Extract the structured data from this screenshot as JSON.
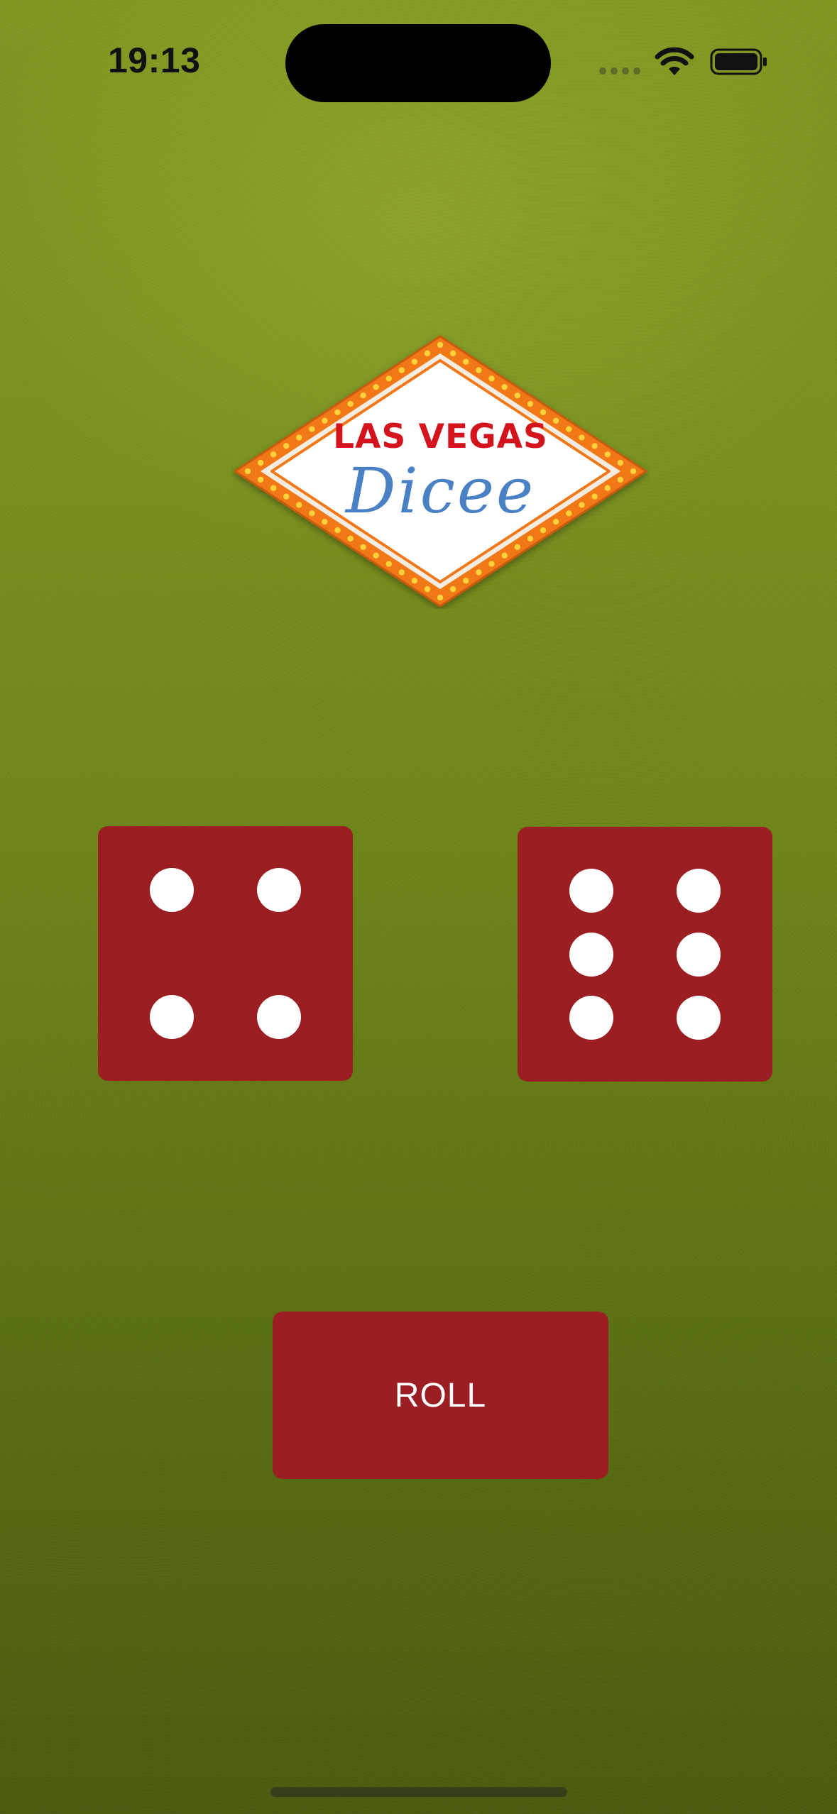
{
  "status_bar": {
    "time": "19:13",
    "icons": [
      "cellular-signal-icon",
      "wifi-icon",
      "battery-icon"
    ]
  },
  "logo": {
    "title": "LAS VEGAS",
    "script": "Dicee"
  },
  "dice": [
    {
      "name": "left-die",
      "value": 4
    },
    {
      "name": "right-die",
      "value": 6
    }
  ],
  "roll_button": {
    "label": "ROLL"
  },
  "colors": {
    "felt": "#7a921f",
    "dice_red": "#9b1e22",
    "logo_red": "#d4141c",
    "logo_blue": "#4a80c4",
    "marquee_orange": "#f07818"
  }
}
